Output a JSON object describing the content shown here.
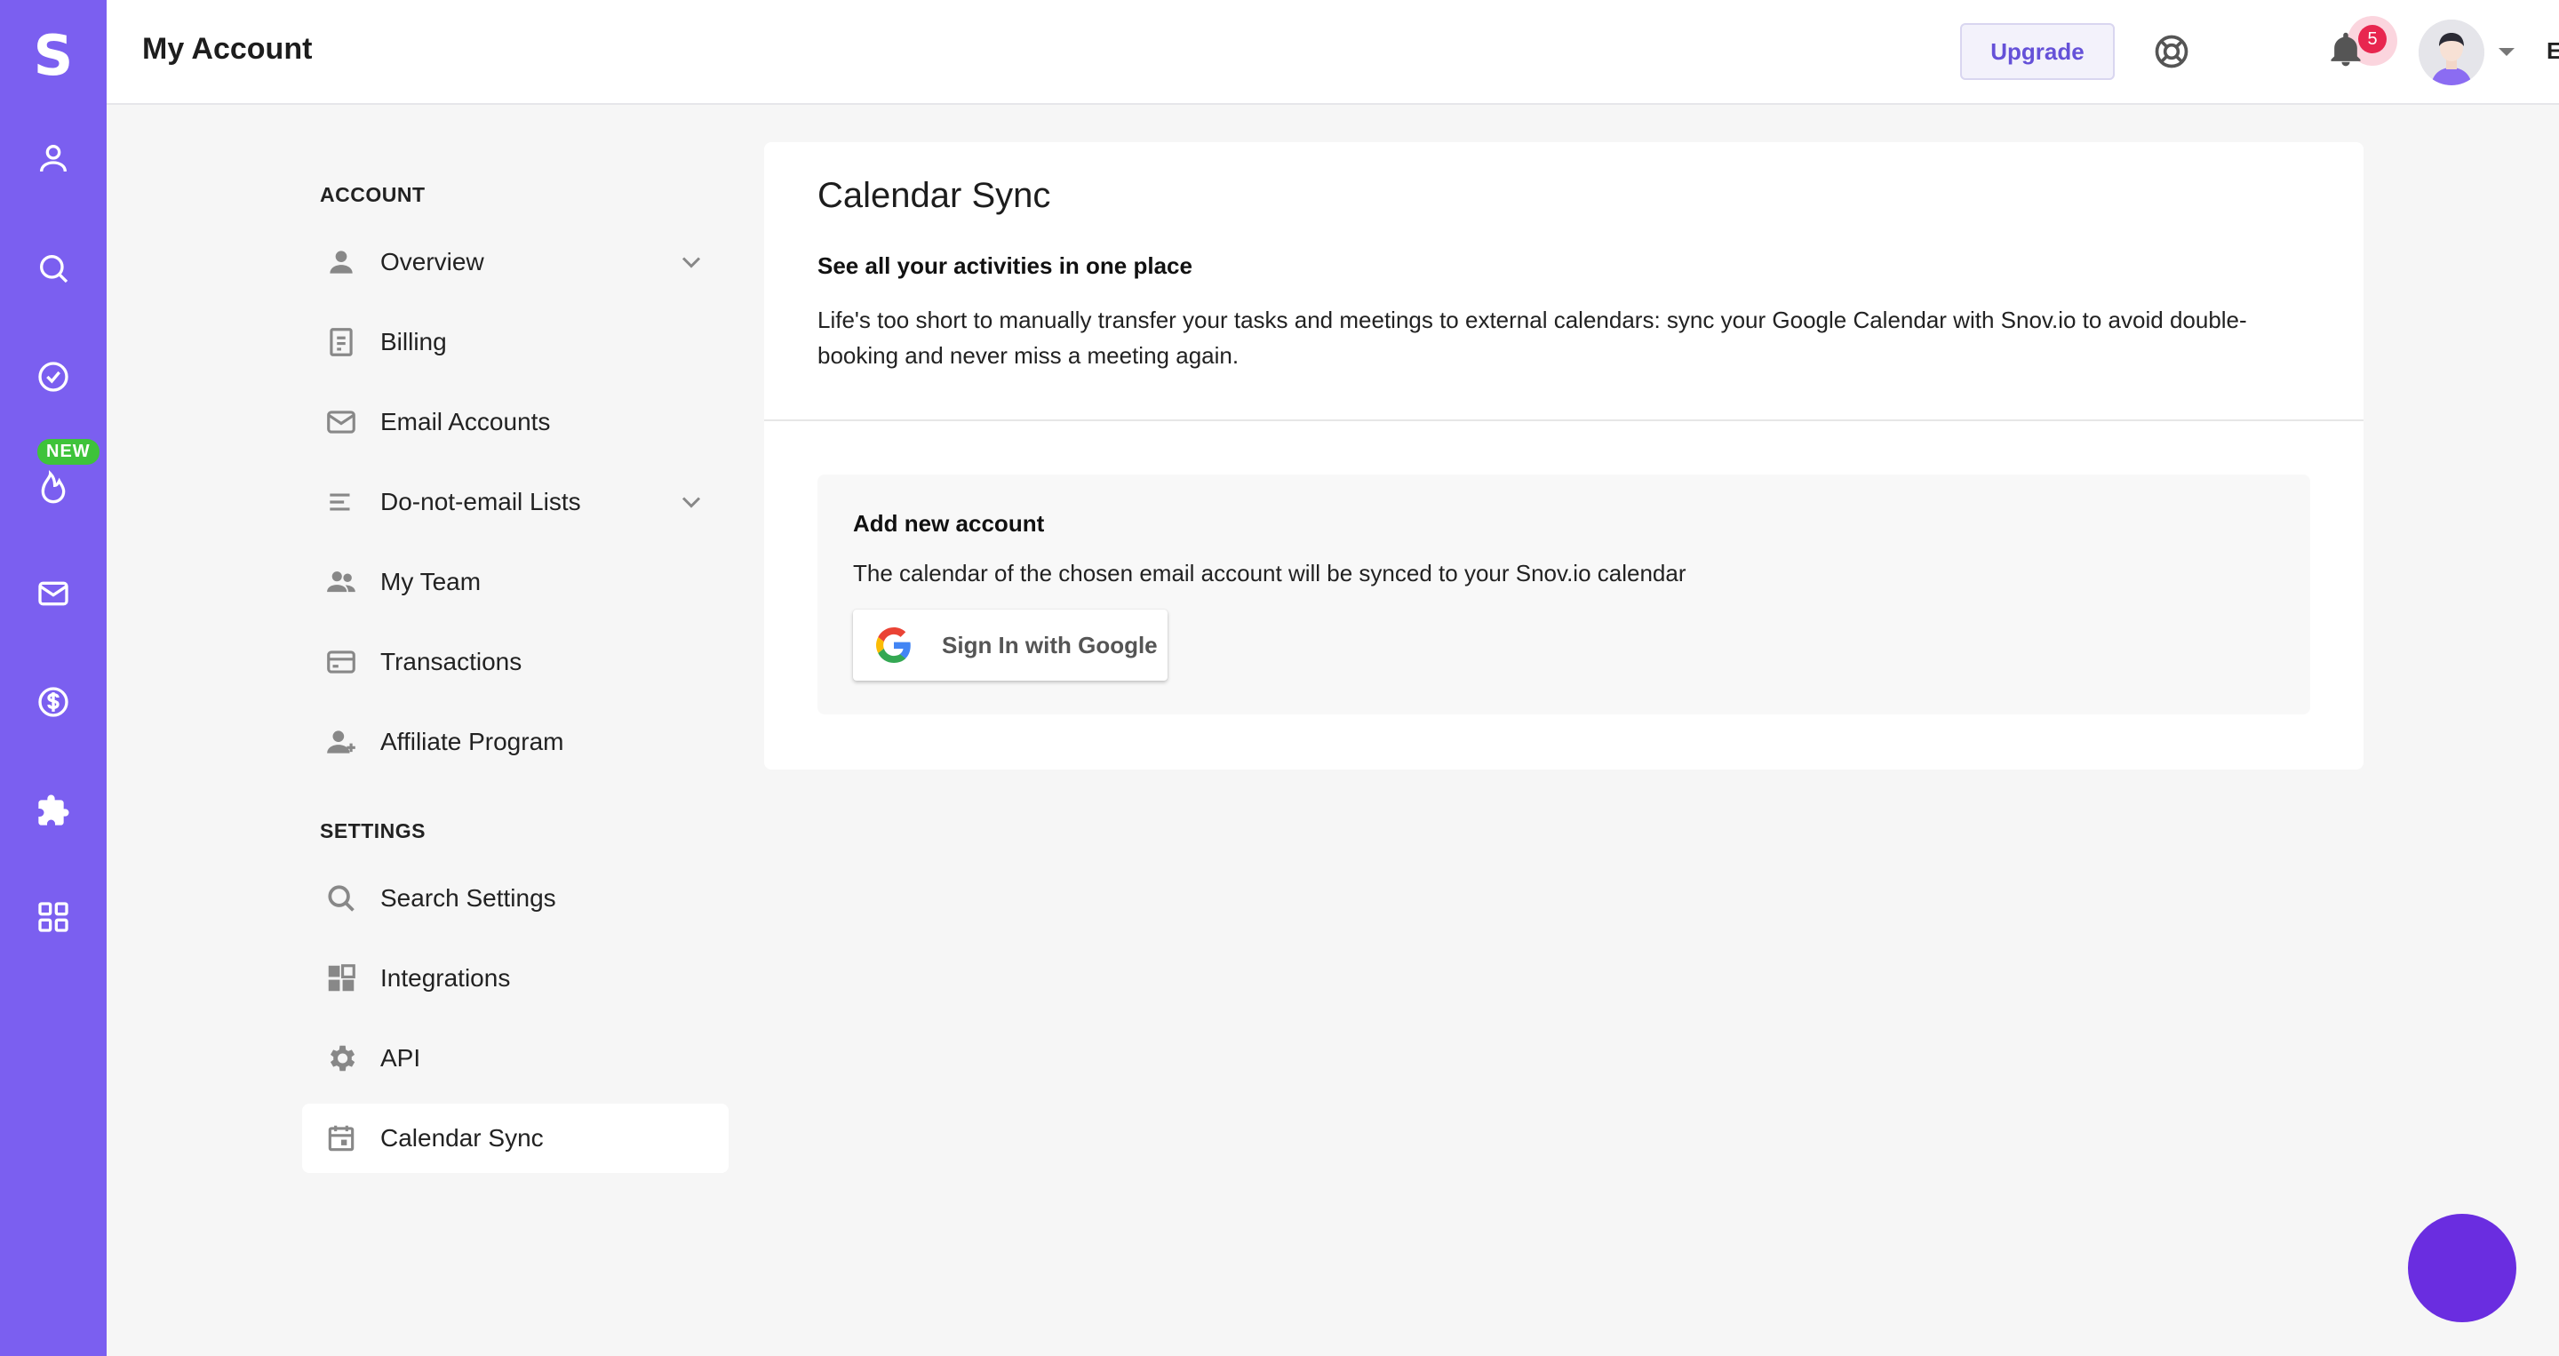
{
  "rail": {
    "logo": "S",
    "new_badge": "NEW",
    "icons": [
      "person-icon",
      "search-icon",
      "check-circle-icon",
      "flame-icon",
      "mail-icon",
      "dollar-icon",
      "puzzle-icon",
      "apps-grid-icon"
    ]
  },
  "header": {
    "title": "My Account",
    "upgrade_label": "Upgrade",
    "notification_count": "5",
    "language": "EN"
  },
  "nav": {
    "account_section": "ACCOUNT",
    "settings_section": "SETTINGS",
    "items": [
      {
        "label": "Overview"
      },
      {
        "label": "Billing"
      },
      {
        "label": "Email Accounts"
      },
      {
        "label": "Do-not-email Lists"
      },
      {
        "label": "My Team"
      },
      {
        "label": "Transactions"
      },
      {
        "label": "Affiliate Program"
      },
      {
        "label": "Search Settings"
      },
      {
        "label": "Integrations"
      },
      {
        "label": "API"
      },
      {
        "label": "Calendar Sync"
      }
    ],
    "active": "Calendar Sync"
  },
  "main": {
    "title": "Calendar Sync",
    "subtitle": "See all your activities in one place",
    "description": "Life's too short to manually transfer your tasks and meetings to external calendars: sync your Google Calendar with Snov.io to avoid double-booking and never miss a meeting again.",
    "add_account": {
      "title": "Add new account",
      "description": "The calendar of the chosen email account will be synced to your Snov.io calendar",
      "button_label": "Sign In with Google"
    }
  },
  "colors": {
    "rail": "#7b5ff0",
    "accent": "#6551d8",
    "badge_red": "#e8264f",
    "new_green": "#3ec33a",
    "chat_button": "#6a2de0"
  }
}
